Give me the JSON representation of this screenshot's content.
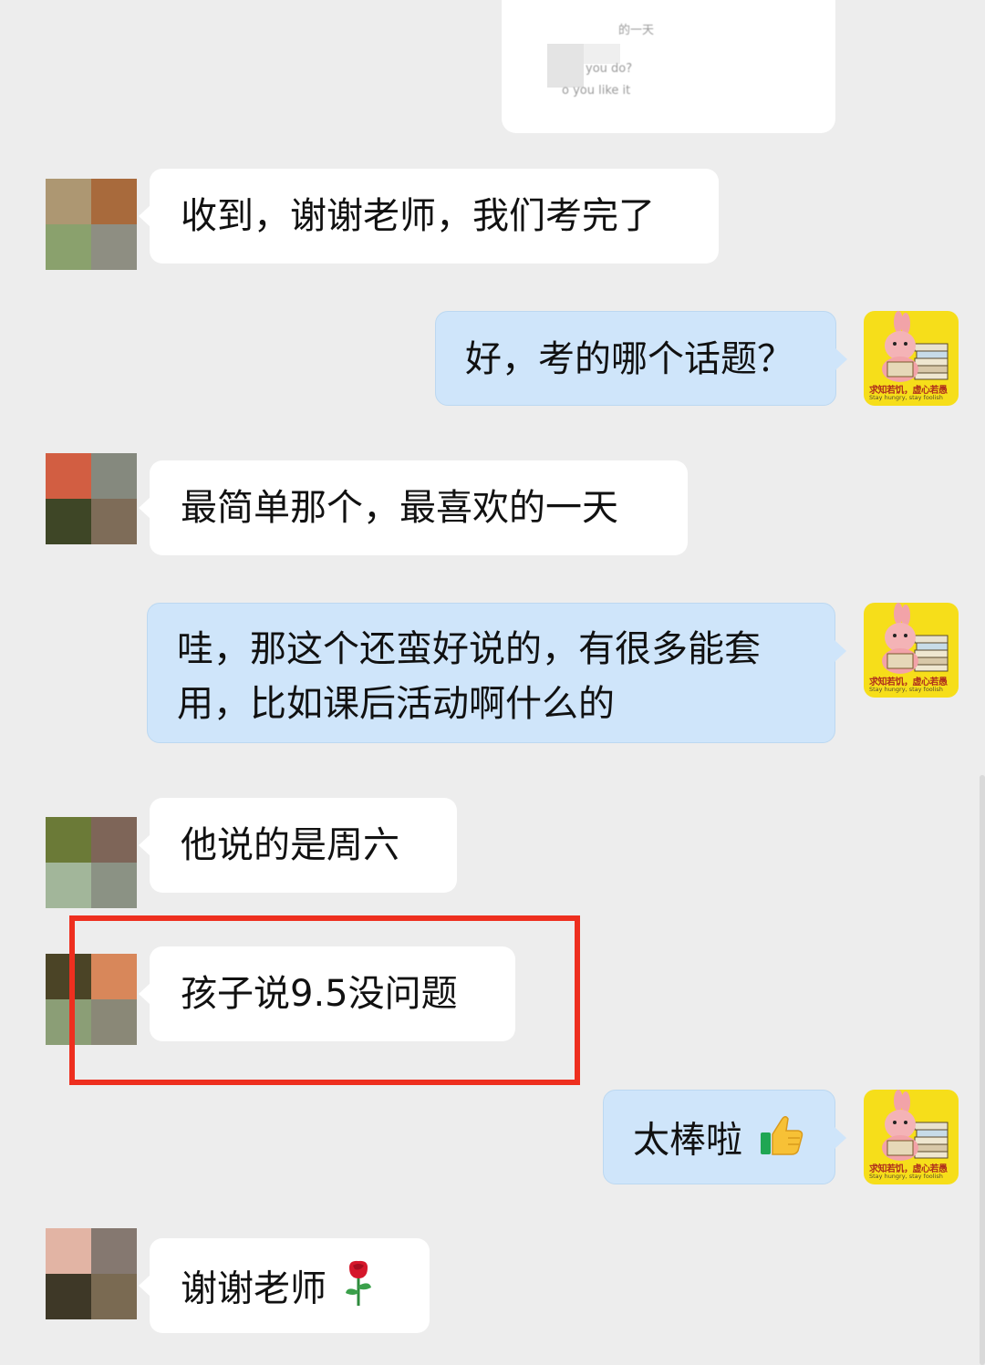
{
  "quote_image": {
    "line1": "的一天",
    "line2": "you do?",
    "line3": "o you like it"
  },
  "logo_avatar": {
    "title": "求知若饥，虚心若愚",
    "subtitle": "Stay hungry, stay foolish"
  },
  "messages": [
    {
      "id": "m1",
      "side": "in",
      "text": "收到，谢谢老师，我们考完了",
      "avatar_colors": [
        "#ad9772",
        "#a86a3c",
        "#8aa16d",
        "#8e8e82"
      ]
    },
    {
      "id": "m2",
      "side": "out",
      "text": "好，考的哪个话题？"
    },
    {
      "id": "m3",
      "side": "in",
      "text": "最简单那个，最喜欢的一天",
      "avatar_colors": [
        "#d25e42",
        "#85897e",
        "#3e4626",
        "#7e6c58"
      ]
    },
    {
      "id": "m4",
      "side": "out",
      "line1": "哇，那这个还蛮好说的，有很多能套",
      "line2": "用，比如课后活动啊什么的"
    },
    {
      "id": "m5",
      "side": "in",
      "text": "他说的是周六",
      "avatar_colors": [
        "#6b7a37",
        "#7e6558",
        "#a2b69a",
        "#8b9284"
      ]
    },
    {
      "id": "m6",
      "side": "in",
      "text": "孩子说9.5没问题",
      "avatar_colors": [
        "#4b4426",
        "#d8875a",
        "#8b9e76",
        "#8a8877"
      ],
      "highlighted": true
    },
    {
      "id": "m7",
      "side": "out",
      "text": "太棒啦",
      "emoji": "thumbs-up-icon"
    },
    {
      "id": "m8",
      "side": "in",
      "text": "谢谢老师",
      "emoji": "rose-icon",
      "avatar_colors": [
        "#e2b4a4",
        "#857870",
        "#3e3827",
        "#7a6a52"
      ]
    }
  ],
  "colors": {
    "background": "#ededed",
    "incoming_bubble": "#ffffff",
    "outgoing_bubble": "#cfe5fa",
    "highlight": "#ee2f1f"
  }
}
